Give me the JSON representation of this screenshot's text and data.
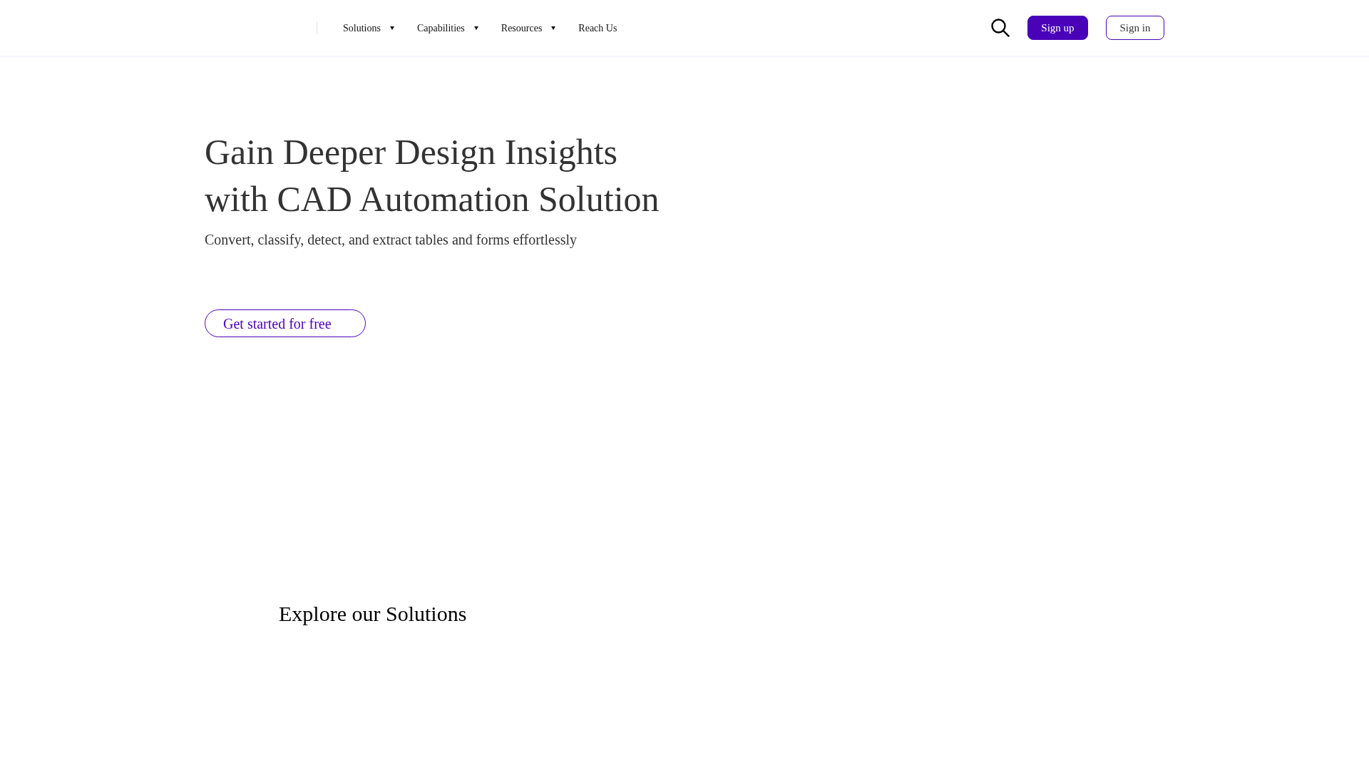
{
  "header": {
    "nav_items": [
      {
        "label": "Solutions",
        "has_menu": true
      },
      {
        "label": "Capabilities",
        "has_menu": true
      },
      {
        "label": "Resources",
        "has_menu": true
      },
      {
        "label": "Reach Us",
        "has_menu": false
      }
    ],
    "buttons": [
      {
        "label": "Sign up",
        "kind": "primary"
      },
      {
        "label": "Sign in",
        "kind": "outline"
      }
    ]
  },
  "hero": {
    "title": "Gain Deeper Design Insights with CAD Automation Solution",
    "subtitle": "Convert, classify, detect, and extract tables and forms effortlessly",
    "cta": "Get started for free"
  },
  "solutions": {
    "title": "Explore our Solutions"
  }
}
